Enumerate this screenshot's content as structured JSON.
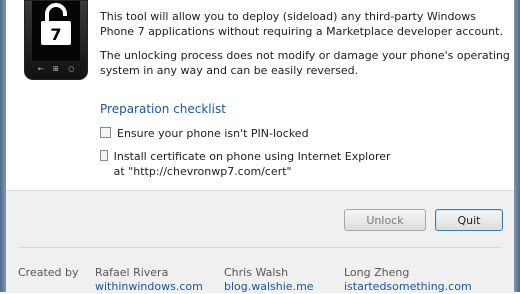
{
  "main": {
    "description_1": "This tool will allow you to deploy (sideload) any third-party Windows Phone 7 applications without requiring a Marketplace developer account.",
    "description_2": "The unlocking process does not modify or damage your phone's operating system in any way and can be easily reversed.",
    "checklist_title": "Preparation checklist",
    "checklist": [
      {
        "label": "Ensure your phone isn't PIN-locked",
        "checked": false
      },
      {
        "label": "Install certificate on phone using Internet Explorer at \"http://chevronwp7.com/cert\"",
        "checked": false
      }
    ]
  },
  "phone": {
    "screen_glyph": "7",
    "icon": "unlocked-padlock-icon"
  },
  "buttons": {
    "unlock_label": "Unlock",
    "quit_label": "Quit"
  },
  "credits": {
    "label": "Created by",
    "people": [
      {
        "name": "Rafael Rivera",
        "link": "withinwindows.com"
      },
      {
        "name": "Chris Walsh",
        "link": "blog.walshie.me"
      },
      {
        "name": "Long Zheng",
        "link": "istartedsomething.com"
      }
    ]
  },
  "colors": {
    "accent": "#1e56a0",
    "frame": "#5f7b98"
  }
}
